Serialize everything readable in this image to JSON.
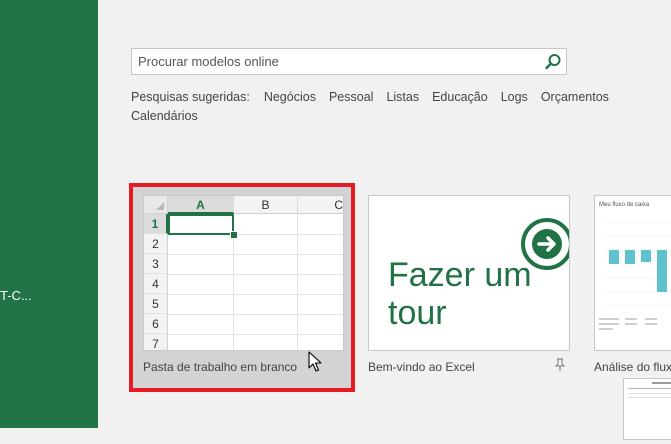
{
  "sidebar": {
    "partial_text": "T-C..."
  },
  "search": {
    "placeholder": "Procurar modelos online",
    "icon": "search-icon"
  },
  "suggested": {
    "label": "Pesquisas sugeridas:",
    "links": [
      "Negócios",
      "Pessoal",
      "Listas",
      "Educação",
      "Logs",
      "Orçamentos",
      "Calendários"
    ]
  },
  "templates": [
    {
      "label": "Pasta de trabalho em branco",
      "columns": [
        "A",
        "B",
        "C"
      ],
      "rows": [
        "1",
        "2",
        "3",
        "4",
        "5",
        "6",
        "7"
      ]
    },
    {
      "label": "Bem-vindo ao Excel",
      "thumb_text": "Fazer um tour"
    },
    {
      "label": "Análise do flux",
      "thumb_title": "Meu fluxo de caixa"
    }
  ],
  "colors": {
    "accent": "#217346",
    "selection": "#e51c24",
    "teal": "#5fc2cf"
  }
}
